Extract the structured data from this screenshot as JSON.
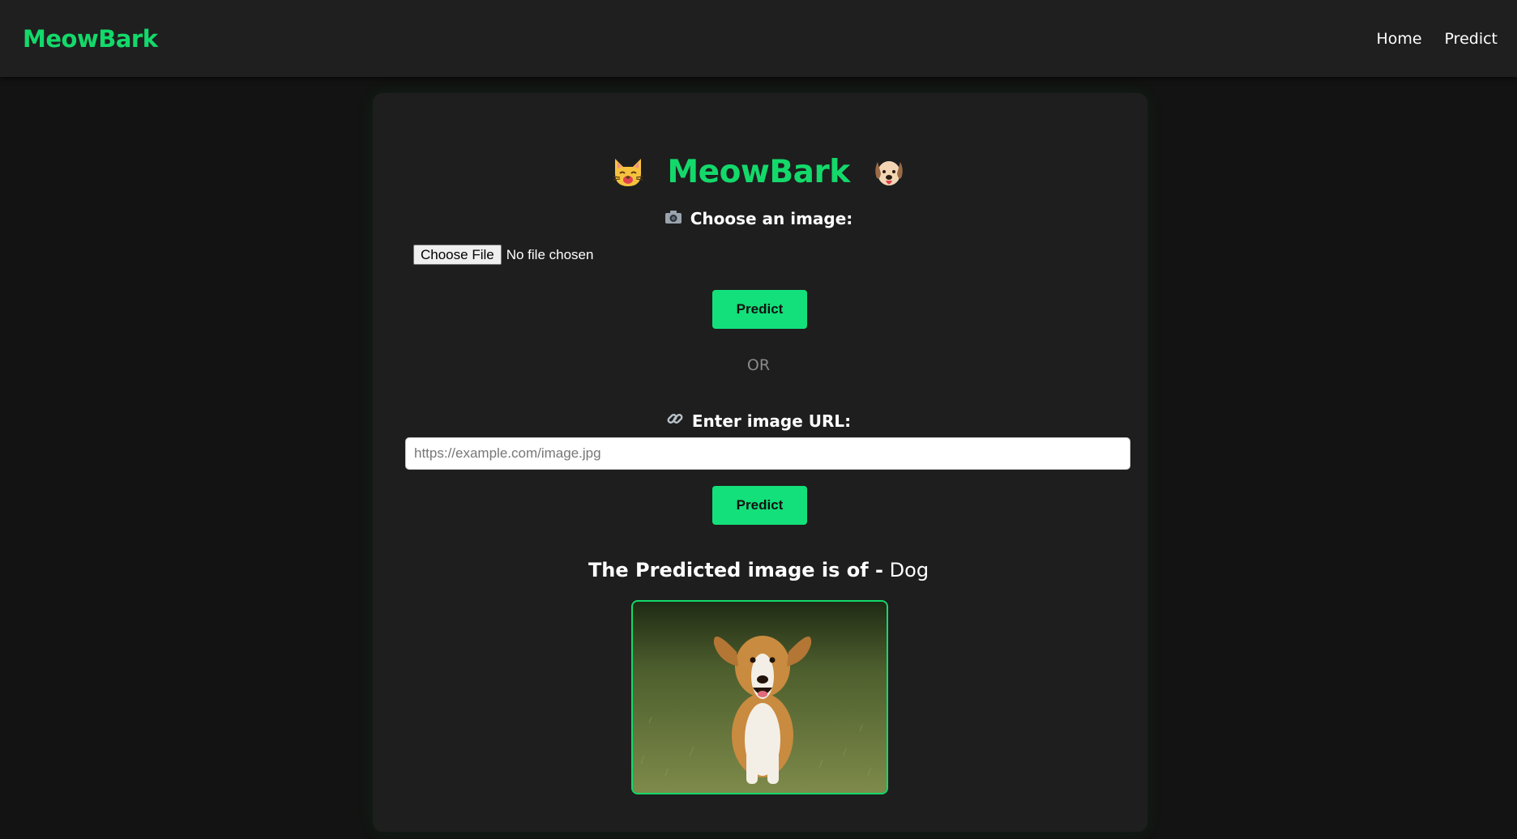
{
  "navbar": {
    "brand": "MeowBark",
    "links": [
      {
        "label": "Home"
      },
      {
        "label": "Predict"
      }
    ]
  },
  "main": {
    "title": "MeowBark",
    "title_icons": [
      "cat-face-icon",
      "dog-face-icon"
    ],
    "file_section": {
      "label": "Choose an image:",
      "icon": "camera-icon",
      "file_button_label": "Choose File",
      "file_status": "No file chosen",
      "predict_label": "Predict"
    },
    "or_text": "OR",
    "url_section": {
      "label": "Enter image URL:",
      "icon": "link-icon",
      "placeholder": "https://example.com/image.jpg",
      "value": "",
      "predict_label": "Predict"
    },
    "result": {
      "lead": "The Predicted image is of -",
      "value": "Dog"
    },
    "preview_image": "running-beagle-dog-photo"
  },
  "colors": {
    "accent": "#13d96b",
    "button": "#13e07a",
    "background": "#121312",
    "card": "#1e1e1e",
    "navbar": "#1f1f1f"
  }
}
